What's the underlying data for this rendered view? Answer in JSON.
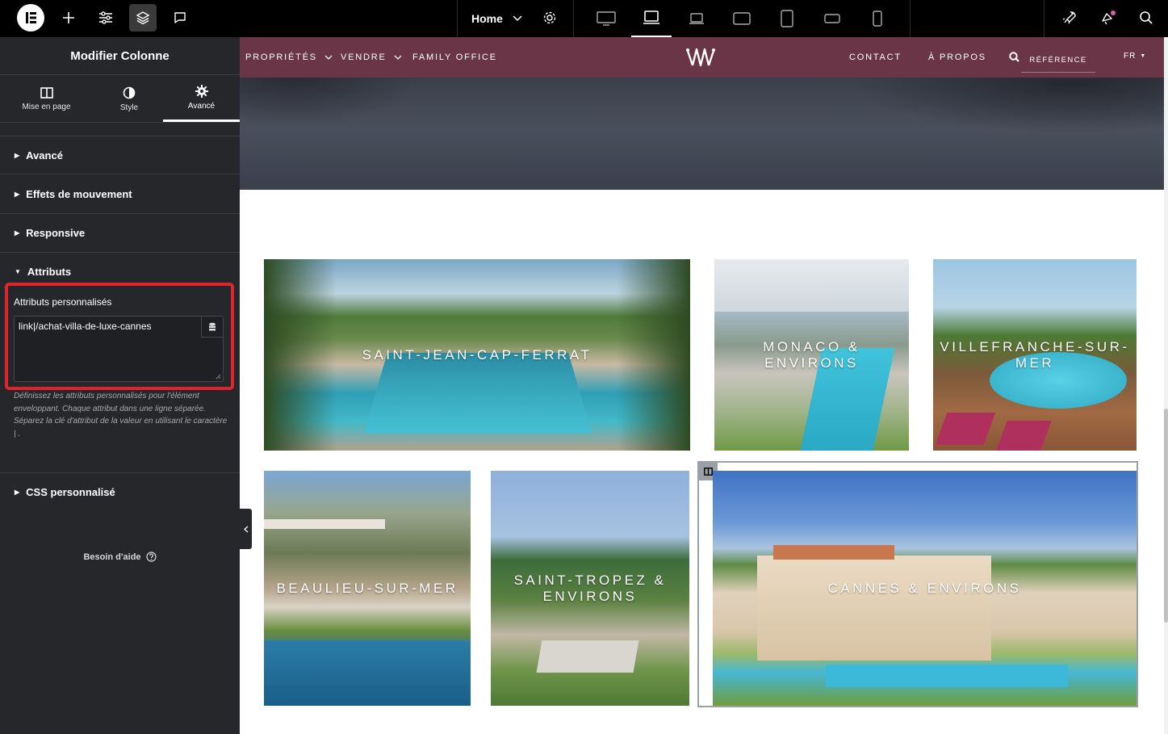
{
  "topbar": {
    "page_selector": "Home",
    "icons": [
      "elementor-logo-icon",
      "add-icon",
      "sliders-icon",
      "layers-icon",
      "comment-icon",
      "settings-gear-icon",
      "desktop-icon",
      "laptop-icon",
      "tablet-landscape-icon",
      "tablet-portrait-icon",
      "mobile-landscape-icon",
      "mobile-portrait-icon",
      "rocket-icon",
      "notifications-icon",
      "search-icon"
    ]
  },
  "panel": {
    "title": "Modifier Colonne",
    "tabs": [
      {
        "label": "Mise en page",
        "icon": "columns-icon"
      },
      {
        "label": "Style",
        "icon": "contrast-icon"
      },
      {
        "label": "Avancé",
        "icon": "gear-icon",
        "active": true
      }
    ],
    "sections": [
      "Avancé",
      "Effets de mouvement",
      "Responsive",
      "Attributs",
      "CSS personnalisé"
    ],
    "attributes": {
      "label": "Attributs personnalisés",
      "value": "link|/achat-villa-de-luxe-cannes",
      "help": "Définissez les attributs personnalisés pour l'élément enveloppant. Chaque attribut dans une ligne séparée. Séparez la clé d'attribut de la valeur en utilisant le caractère | ."
    },
    "help_link": "Besoin d'aide"
  },
  "site": {
    "nav": {
      "left": [
        "PROPRIÉTÉS",
        "VENDRE",
        "FAMILY OFFICE"
      ],
      "right": [
        "CONTACT",
        "À PROPOS"
      ],
      "search_placeholder": "RÉFÉRENCE",
      "language": "FR"
    },
    "tiles": [
      {
        "label": "SAINT-JEAN-CAP-FERRAT"
      },
      {
        "label": "MONACO & ENVIRONS"
      },
      {
        "label": "VILLEFRANCHE-SUR-MER"
      },
      {
        "label": "BEAULIEU-SUR-MER"
      },
      {
        "label": "SAINT-TROPEZ & ENVIRONS"
      },
      {
        "label": "CANNES & ENVIRONS"
      }
    ]
  },
  "colors": {
    "topbar": "#000000",
    "panel": "#26272b",
    "nav": "#6b3548",
    "highlight": "#e0242b"
  }
}
